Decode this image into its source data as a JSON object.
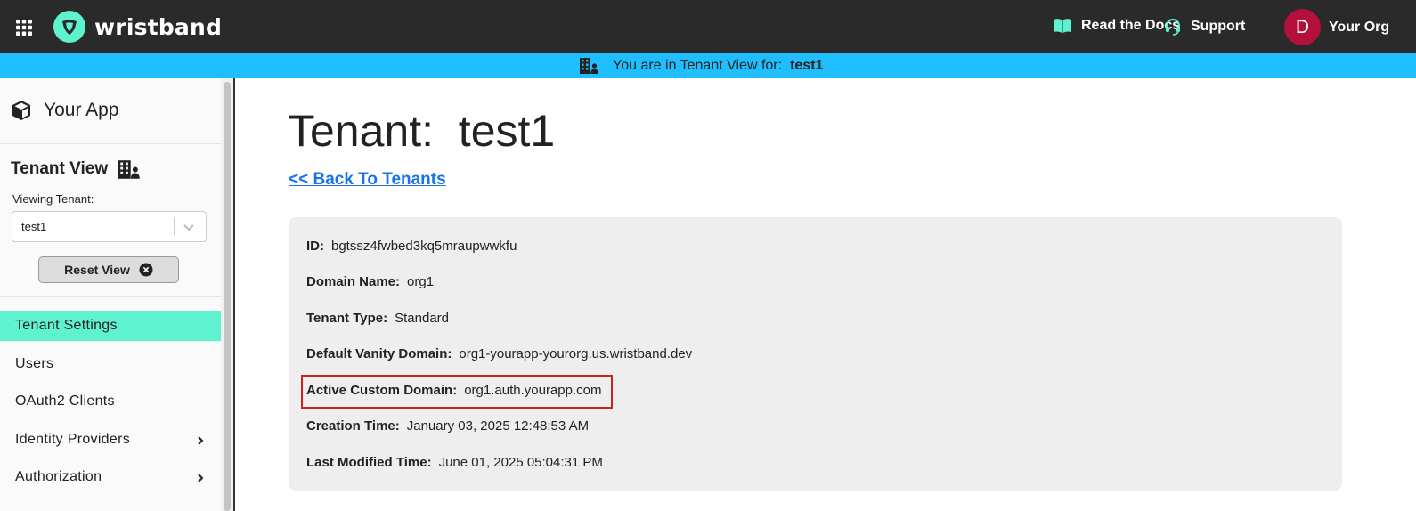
{
  "header": {
    "brand_name": "wristband",
    "docs_label": "Read the Docs",
    "support_label": "Support",
    "avatar_initial": "D",
    "org_name": "Your Org",
    "brand_color": "#5ff2cf",
    "avatar_color": "#b5103c"
  },
  "banner": {
    "text": "You are in Tenant View for:",
    "tenant": "test1",
    "color": "#1fbfff"
  },
  "sidebar": {
    "app_name": "Your App",
    "tenant_view_title": "Tenant View",
    "viewing_label": "Viewing Tenant:",
    "viewing_value": "test1",
    "reset_label": "Reset View",
    "items": [
      {
        "label": "Tenant Settings",
        "active": true,
        "has_chevron": false
      },
      {
        "label": "Users",
        "active": false,
        "has_chevron": false
      },
      {
        "label": "OAuth2 Clients",
        "active": false,
        "has_chevron": false
      },
      {
        "label": "Identity Providers",
        "active": false,
        "has_chevron": true
      },
      {
        "label": "Authorization",
        "active": false,
        "has_chevron": true
      }
    ]
  },
  "main": {
    "title": "Tenant:  test1",
    "back_link": "<< Back To Tenants",
    "fields": [
      {
        "label": "ID:",
        "value": "bgtssz4fwbed3kq5mraupwwkfu"
      },
      {
        "label": "Domain Name:",
        "value": "org1"
      },
      {
        "label": "Tenant Type:",
        "value": "Standard"
      },
      {
        "label": "Default Vanity Domain:",
        "value": "org1-yourapp-yourorg.us.wristband.dev"
      },
      {
        "label": "Active Custom Domain:",
        "value": "org1.auth.yourapp.com"
      },
      {
        "label": "Creation Time:",
        "value": "January 03, 2025 12:48:53 AM"
      },
      {
        "label": "Last Modified Time:",
        "value": "June 01, 2025 05:04:31 PM"
      }
    ],
    "highlight_color": "#d02020"
  }
}
